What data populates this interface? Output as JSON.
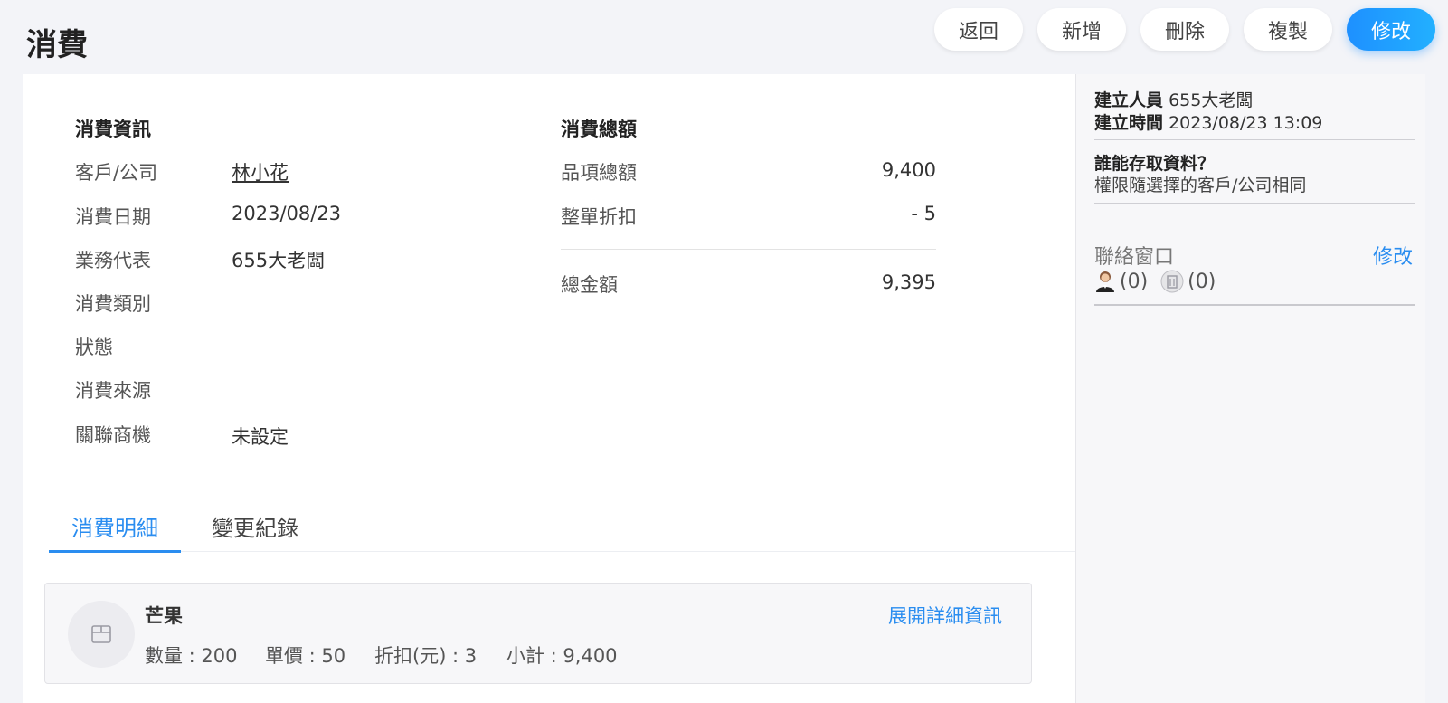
{
  "page": {
    "title": "消費"
  },
  "toolbar": {
    "back_label": "返回",
    "add_label": "新增",
    "delete_label": "刪除",
    "copy_label": "複製",
    "edit_label": "修改"
  },
  "info": {
    "title": "消費資訊",
    "fields": [
      {
        "label": "客戶/公司",
        "value": "林小花"
      },
      {
        "label": "消費日期",
        "value": "2023/08/23"
      },
      {
        "label": "業務代表",
        "value": "655大老闆"
      },
      {
        "label": "消費類別",
        "value": ""
      },
      {
        "label": "狀態",
        "value": ""
      },
      {
        "label": "消費來源",
        "value": ""
      },
      {
        "label": "關聯商機",
        "value": "未設定"
      }
    ]
  },
  "summary": {
    "title": "消費總額",
    "items_total_label": "品項總額",
    "items_total_value": "9,400",
    "discount_label": "整單折扣",
    "discount_value": "- 5",
    "grand_total_label": "總金額",
    "grand_total_value": "9,395"
  },
  "tabs": [
    {
      "label": "消費明細",
      "active": true
    },
    {
      "label": "變更紀錄",
      "active": false
    }
  ],
  "items": [
    {
      "name": "芒果",
      "expand_label": "展開詳細資訊",
      "quantity": "數量 : 200",
      "unit_price": "單價 : 50",
      "discount": "折扣(元) : 3",
      "subtotal": "小計 : 9,400"
    }
  ],
  "side": {
    "creator_label": "建立人員",
    "creator_value": "655大老闆",
    "created_label": "建立時間",
    "created_value": "2023/08/23 13:09",
    "access_title": "誰能存取資料？",
    "access_desc": "權限隨選擇的客戶/公司相同",
    "contact_title": "聯絡窗口",
    "contact_edit": "修改",
    "person_count": "(0)",
    "company_count": "(0)"
  },
  "colors": {
    "accent": "#2a8df0",
    "primary_button": "#1e90ff",
    "background": "#f3f4f8"
  }
}
